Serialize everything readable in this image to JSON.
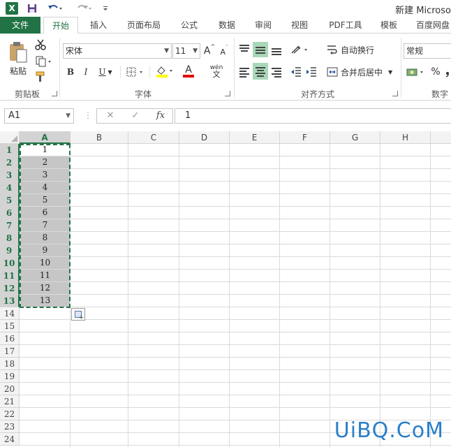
{
  "window": {
    "title": "新建 Microso"
  },
  "quick_access": {
    "app_icon": "excel-icon",
    "logo_text": "X",
    "items": [
      "save-icon",
      "undo-icon",
      "redo-icon",
      "customize-icon"
    ]
  },
  "tabs": [
    "文件",
    "开始",
    "插入",
    "页面布局",
    "公式",
    "数据",
    "审阅",
    "视图",
    "PDF工具",
    "模板",
    "百度网盘"
  ],
  "active_tab": "开始",
  "ribbon": {
    "clipboard": {
      "label": "剪贴板",
      "paste": "粘贴"
    },
    "font": {
      "label": "字体",
      "name": "宋体",
      "size": "11",
      "grow": "A",
      "shrink": "A",
      "bold": "B",
      "italic": "I",
      "underline": "U",
      "font_color": "A",
      "phonetic": "wén"
    },
    "alignment": {
      "label": "对齐方式",
      "wrap": "自动换行",
      "merge": "合并后居中"
    },
    "number": {
      "label": "数字",
      "format": "常规",
      "percent": "%"
    }
  },
  "formula_bar": {
    "name_box": "A1",
    "cancel": "✕",
    "enter": "✓",
    "fx": "fx",
    "value": "1"
  },
  "columns": [
    "A",
    "B",
    "C",
    "D",
    "E",
    "F",
    "G",
    "H"
  ],
  "rows": [
    "1",
    "2",
    "3",
    "4",
    "5",
    "6",
    "7",
    "8",
    "9",
    "10",
    "11",
    "12",
    "13",
    "14",
    "15",
    "16",
    "17",
    "18",
    "19",
    "20",
    "21",
    "22",
    "23",
    "24"
  ],
  "cells_a": [
    "1",
    "2",
    "3",
    "4",
    "5",
    "6",
    "7",
    "8",
    "9",
    "10",
    "11",
    "12",
    "13"
  ],
  "watermark": "UiBQ.CoM",
  "colors": {
    "accent": "#217346",
    "selection": "#c6c6c6",
    "watermark": "#2a7fc9"
  }
}
